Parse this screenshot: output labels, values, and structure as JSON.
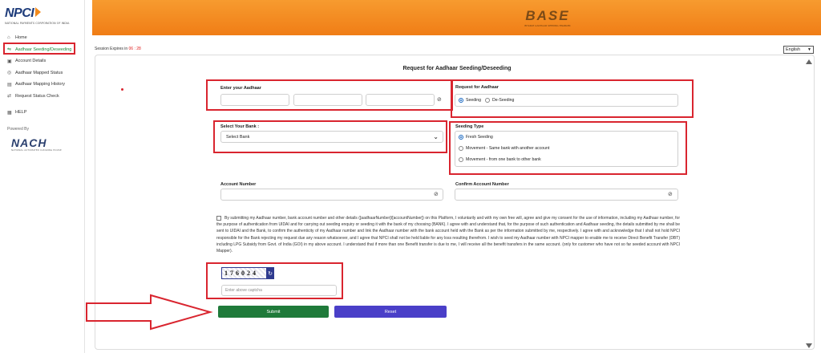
{
  "sidebar": {
    "logo_text": "NPCI",
    "logo_sub": "NATIONAL PAYMENTS CORPORATION OF INDIA",
    "items": [
      {
        "label": "Home",
        "icon": "home-icon"
      },
      {
        "label": "Aadhaar Seeding/Deseeding",
        "icon": "seeding-icon"
      },
      {
        "label": "Account Details",
        "icon": "account-icon"
      },
      {
        "label": "Aadhaar Mapped Status",
        "icon": "status-icon"
      },
      {
        "label": "Aadhaar Mapping History",
        "icon": "history-icon"
      },
      {
        "label": "Request Status Check",
        "icon": "swap-icon"
      }
    ],
    "help": "HELP",
    "powered_by": "Powered By",
    "nach_logo": "NACH",
    "nach_sub": "NATIONAL AUTOMATED CLEARING HOUSE"
  },
  "header": {
    "logo_text": "BASE",
    "logo_sub": "BHARAT AADHAAR SEEDING ENABLER",
    "color": "#f07d16"
  },
  "session": {
    "label": "Session Expires in",
    "timer": "06 : 28"
  },
  "language": {
    "selected": "English"
  },
  "form": {
    "title": "Request for Aadhaar Seeding/Deseeding",
    "aadhaar_label": "Enter your Aadhaar",
    "request_label": "Request for Aadhaar",
    "request_options": [
      "Seeding",
      "De-Seeding"
    ],
    "bank_label": "Select Your Bank :",
    "bank_placeholder": "Select Bank",
    "seeding_type_label": "Seeding Type",
    "seeding_type_options": [
      "Fresh Seeding",
      "Movement - Same bank with another account",
      "Movement - from one bank to other bank"
    ],
    "account_label": "Account Number",
    "confirm_account_label": "Confirm Account Number",
    "consent": "By submitting my Aadhaar number, bank account number and other details ([aadhaarNumber]/[accountNumber]) on this Platform, I voluntarily and with my own free will, agree and give my consent for the use of information, including my Aadhaar number, for the purpose of authentication from UIDAI and for carrying out seeding enquiry or seeding it with the bank of my choosing (BANK). I agree with and understand that, for the purpose of such authentication and Aadhaar seeding, the details submitted by me shall be sent to UIDAI and the Bank, to confirm the authenticity of my Aadhaar number and link the Aadhaar number with the bank account held with the Bank as per the information submitted by me, respectively. I agree with and acknowledge that I shall not hold NPCI responsible for the Bank rejecting my request due any reason whatsoever, and I agree that NPCI shall not be held liable for any loss resulting therefrom. I wish to seed my Aadhaar number with NPCI mapper to enable me to receive Direct Benefit Transfer (DBT) including LPG Subsidy from Govt. of India (GOI) in my above account. I understand that if more than one Benefit transfer is due to me, I will receive all the benefit transfers in the same account. (only for customer who have not so far seeded account with NPCI Mapper).",
    "captcha_text": "176024",
    "captcha_placeholder": "Enter above captcha",
    "submit_label": "Submit",
    "reset_label": "Reset"
  },
  "colors": {
    "highlight": "#d9252f",
    "submit": "#1f7a3a",
    "reset": "#4a3fc8",
    "active_nav": "#1a8a3a"
  }
}
